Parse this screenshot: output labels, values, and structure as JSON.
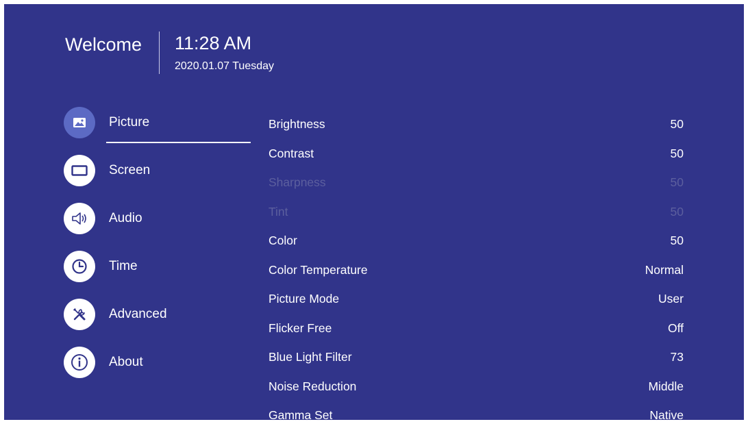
{
  "header": {
    "welcome": "Welcome",
    "time": "11:28 AM",
    "date": "2020.01.07 Tuesday"
  },
  "sidebar": {
    "items": [
      {
        "label": "Picture",
        "icon": "picture-icon",
        "active": true
      },
      {
        "label": "Screen",
        "icon": "screen-icon",
        "active": false
      },
      {
        "label": "Audio",
        "icon": "audio-icon",
        "active": false
      },
      {
        "label": "Time",
        "icon": "clock-icon",
        "active": false
      },
      {
        "label": "Advanced",
        "icon": "tools-icon",
        "active": false
      },
      {
        "label": "About",
        "icon": "info-icon",
        "active": false
      }
    ]
  },
  "settings": {
    "rows": [
      {
        "label": "Brightness",
        "value": "50",
        "enabled": true
      },
      {
        "label": "Contrast",
        "value": "50",
        "enabled": true
      },
      {
        "label": "Sharpness",
        "value": "50",
        "enabled": false
      },
      {
        "label": "Tint",
        "value": "50",
        "enabled": false
      },
      {
        "label": "Color",
        "value": "50",
        "enabled": true
      },
      {
        "label": "Color Temperature",
        "value": "Normal",
        "enabled": true
      },
      {
        "label": "Picture Mode",
        "value": "User",
        "enabled": true
      },
      {
        "label": "Flicker Free",
        "value": "Off",
        "enabled": true
      },
      {
        "label": "Blue Light Filter",
        "value": "73",
        "enabled": true
      },
      {
        "label": "Noise Reduction",
        "value": "Middle",
        "enabled": true
      },
      {
        "label": "Gamma Set",
        "value": "Native",
        "enabled": true
      }
    ]
  },
  "colors": {
    "background": "#31348a",
    "active_icon_bg": "#5c6ac4",
    "disabled_text": "#5c5f9e"
  }
}
